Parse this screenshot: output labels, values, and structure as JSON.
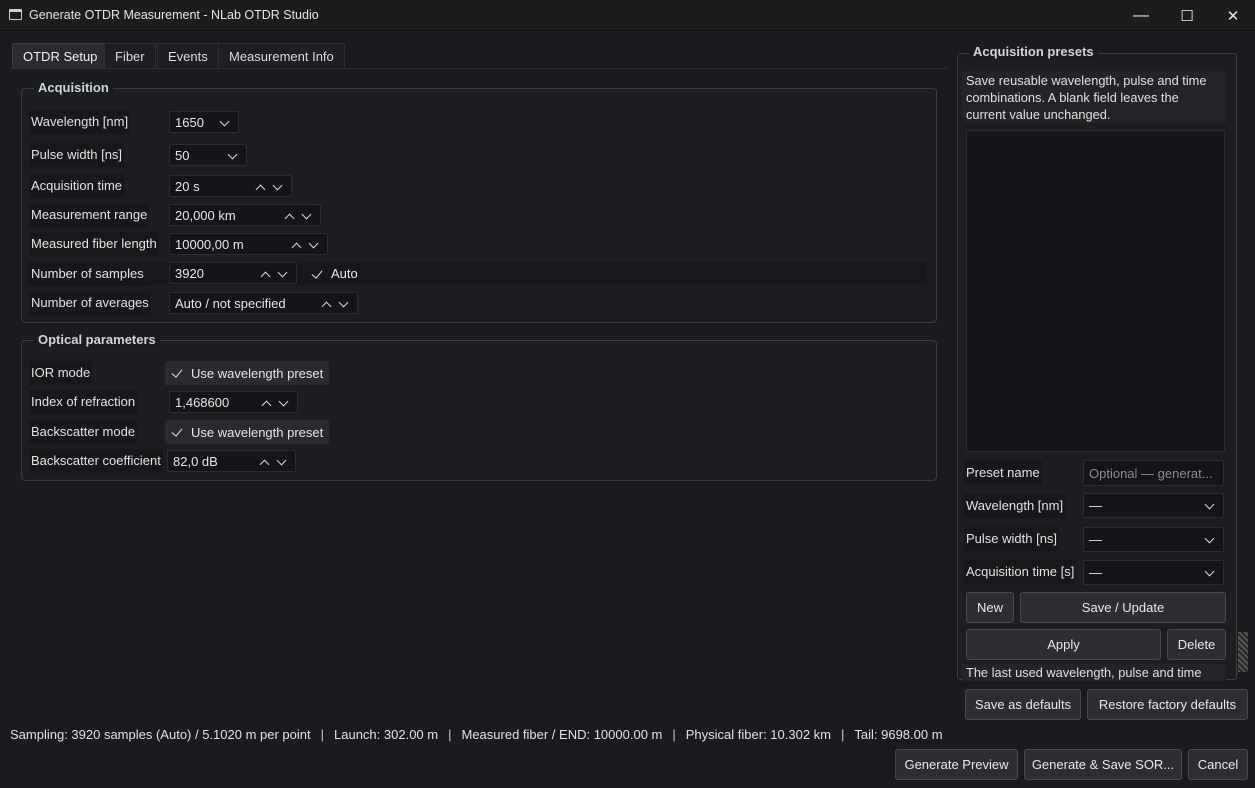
{
  "window": {
    "title": "Generate OTDR Measurement - NLab OTDR Studio",
    "minimize": "—",
    "maximize": "☐",
    "close": "✕"
  },
  "tabs": [
    "OTDR Setup",
    "Fiber",
    "Events",
    "Measurement Info"
  ],
  "acquisition": {
    "title": "Acquisition",
    "wavelength_label": "Wavelength [nm]",
    "wavelength_value": "1650",
    "pulse_label": "Pulse width [ns]",
    "pulse_value": "50",
    "acq_time_label": "Acquisition time",
    "acq_time_value": "20 s",
    "range_label": "Measurement range",
    "range_value": "20,000 km",
    "fiber_len_label": "Measured fiber length",
    "fiber_len_value": "10000,00 m",
    "samples_label": "Number of samples",
    "samples_value": "3920",
    "samples_auto": "Auto",
    "averages_label": "Number of averages",
    "averages_value": "Auto / not specified"
  },
  "optical": {
    "title": "Optical parameters",
    "ior_mode_label": "IOR mode",
    "ior_mode_check": "Use wavelength preset",
    "ior_label": "Index of refraction",
    "ior_value": "1,468600",
    "bs_mode_label": "Backscatter mode",
    "bs_mode_check": "Use wavelength preset",
    "bs_coef_label": "Backscatter coefficient",
    "bs_coef_value": "82,0 dB"
  },
  "presets": {
    "title": "Acquisition presets",
    "description": "Save reusable wavelength, pulse and time combinations. A blank field leaves the current value unchanged.",
    "name_label": "Preset name",
    "name_placeholder": "Optional — generat...",
    "wavelength_label": "Wavelength [nm]",
    "wavelength_value": "—",
    "pulse_label": "Pulse width [ns]",
    "pulse_value": "—",
    "acq_label": "Acquisition time [s]",
    "acq_value": "—",
    "new_button": "New",
    "save_button": "Save / Update",
    "apply_button": "Apply",
    "delete_button": "Delete",
    "footer_text": "The last used wavelength, pulse and time"
  },
  "defaults": {
    "save_defaults": "Save as defaults",
    "restore_defaults": "Restore factory defaults"
  },
  "status": {
    "sampling": "Sampling: 3920 samples (Auto) / 5.1020 m per point",
    "launch": "Launch: 302.00 m",
    "measured": "Measured fiber / END: 10000.00 m",
    "physical": "Physical fiber: 10.302 km",
    "tail": "Tail: 9698.00 m",
    "separator": "|"
  },
  "actions": {
    "preview": "Generate Preview",
    "generate": "Generate & Save SOR...",
    "cancel": "Cancel"
  }
}
